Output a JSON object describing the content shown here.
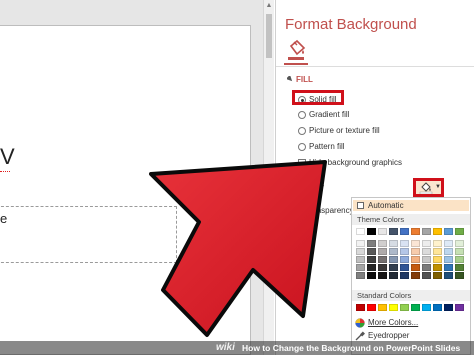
{
  "slide": {
    "title_fragment": "V",
    "placeholder_fragment": "e"
  },
  "pane": {
    "title": "Format Background",
    "section_header": "FILL",
    "fill_options": [
      {
        "label": "Solid fill",
        "selected": true
      },
      {
        "label": "Gradient fill",
        "selected": false
      },
      {
        "label": "Picture or texture fill",
        "selected": false
      },
      {
        "label": "Pattern fill",
        "selected": false
      }
    ],
    "hide_graphics_label": "Hide background graphics",
    "color_label": "Color",
    "transparency_label": "Transparency"
  },
  "color_menu": {
    "automatic_label": "Automatic",
    "theme_colors_label": "Theme Colors",
    "standard_colors_label": "Standard Colors",
    "more_colors_label": "More Colors...",
    "eyedropper_label": "Eyedropper",
    "theme_base": [
      "#ffffff",
      "#000000",
      "#e7e6e6",
      "#44546a",
      "#4472c4",
      "#ed7d31",
      "#a5a5a5",
      "#ffc000",
      "#5b9bd5",
      "#70ad47"
    ],
    "theme_rows": [
      [
        "#f2f2f2",
        "#7f7f7f",
        "#d0cece",
        "#d6dce4",
        "#d9e2f3",
        "#fbe5d5",
        "#ededed",
        "#fff2cc",
        "#deeaf6",
        "#e2efd9"
      ],
      [
        "#d8d8d8",
        "#595959",
        "#aeaaaa",
        "#adb9ca",
        "#b4c6e7",
        "#f7cbac",
        "#dbdbdb",
        "#ffe598",
        "#bdd7ee",
        "#c5e0b3"
      ],
      [
        "#bfbfbf",
        "#3f3f3f",
        "#757070",
        "#8496b0",
        "#8eaadb",
        "#f4b183",
        "#c9c9c9",
        "#ffd965",
        "#9cc3e5",
        "#a8d08d"
      ],
      [
        "#a5a5a5",
        "#262626",
        "#3a3838",
        "#323f4f",
        "#2f5496",
        "#c55a11",
        "#7b7b7b",
        "#bf9000",
        "#2e75b5",
        "#538135"
      ],
      [
        "#7f7f7f",
        "#0c0c0c",
        "#171616",
        "#222a35",
        "#1f3864",
        "#833c0b",
        "#525252",
        "#7f6000",
        "#1e4e79",
        "#375623"
      ]
    ],
    "standard": [
      "#c00000",
      "#ff0000",
      "#ffc000",
      "#ffff00",
      "#92d050",
      "#00b050",
      "#00b0f0",
      "#0070c0",
      "#002060",
      "#7030a0"
    ]
  },
  "caption": {
    "logo": "wiki",
    "text": "How to Change the Background on PowerPoint Slides"
  },
  "colors": {
    "accent": "#c0504d",
    "highlight_red": "#d0101a"
  },
  "icons": [
    "fill-bucket-icon",
    "scroll-up-arrow-icon",
    "chevron-down-icon",
    "color-wheel-icon",
    "eyedropper-icon",
    "big-red-arrow-icon"
  ]
}
